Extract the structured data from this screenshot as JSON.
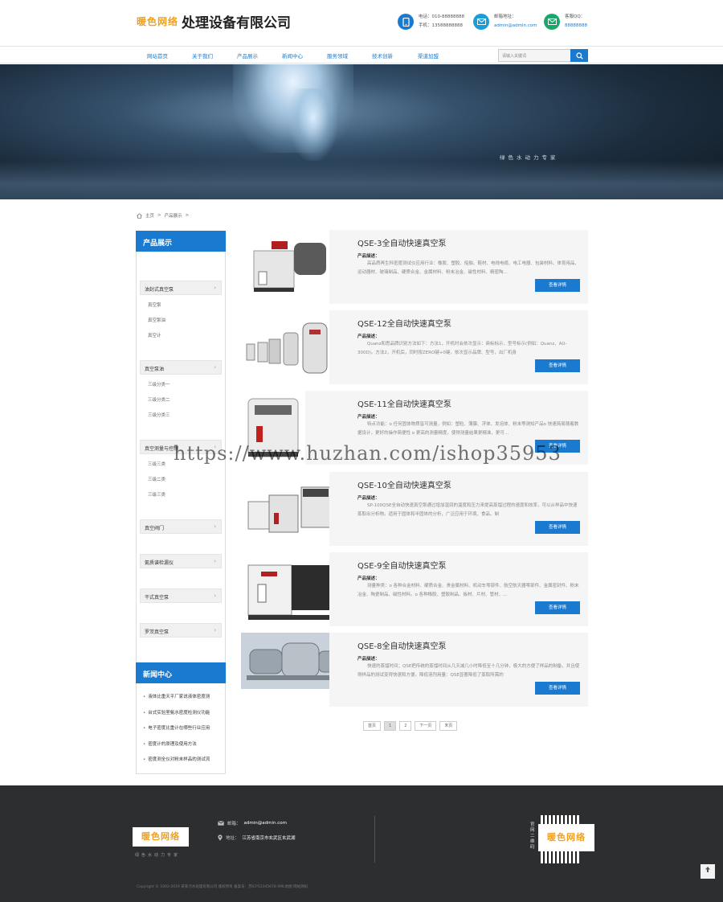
{
  "header": {
    "logo_text": "暖色网络",
    "company_name": "处理设备有限公司",
    "phone_label": "电话：010-88888888",
    "mobile_label": "手机：13588888888",
    "email_label": "邮箱地址：",
    "email_value": "admin@admin.com",
    "qq_label": "客服QQ：",
    "qq_value": "88888888"
  },
  "nav": {
    "items": [
      "网站首页",
      "关于我们",
      "产品展示",
      "新闻中心",
      "服务领域",
      "技术创新",
      "渠道加盟"
    ],
    "search_placeholder": "请输入关键词"
  },
  "banner": {
    "slogan": "绿色水动力专家"
  },
  "breadcrumb": {
    "home": "主页",
    "current": "产品展示"
  },
  "sidebar": {
    "title": "产品展示",
    "categories": [
      {
        "label": "油封式真空泵",
        "subs": [
          "真空泵",
          "真空泵油",
          "真空计"
        ]
      },
      {
        "label": "真空泵油",
        "subs": [
          "三级分类一",
          "三级分类二",
          "三级分类三"
        ]
      },
      {
        "label": "真空测量与控制",
        "subs": [
          "三级三类",
          "三级二类",
          "三级三类"
        ]
      },
      {
        "label": "真空阀门",
        "subs": []
      },
      {
        "label": "氦质谱检漏仪",
        "subs": []
      },
      {
        "label": "干式真空泵",
        "subs": []
      },
      {
        "label": "罗茨真空泵",
        "subs": []
      }
    ],
    "news_title": "新闻中心",
    "news": [
      "液体比重天平厂家说液体密度测",
      "台式实验室氨水密度检测仪功能",
      "电子密度比重计在哪些行业应用",
      "密度计的原理及使用方法",
      "密度测全仪对粉末样品的测试流"
    ]
  },
  "products": {
    "desc_label": "产品描述：",
    "button_label": "查看详情",
    "items": [
      {
        "title": "QSE-3全自动快速真空泵",
        "desc": "高品质再生科密度测试仪应用行业：橡胶、塑胶、船舶、鞋材、电线电缆、电工电器、包装材料、体育用品、运动器材、玻璃制品、硬质合金、金属材料、粉末冶金、磁性材料、精密陶..."
      },
      {
        "title": "QSE-12全自动快速真空泵",
        "desc": "Quanz和思品牌识别方法如下：方法1，开机时会依次显示：商标标示、型号标示(例如：Quanz、AU-300D)。方法2，开机后，同时按ZERO键+0键，依次显示品牌、型号，出厂机身"
      },
      {
        "title": "QSE-11全自动快速真空泵",
        "desc": "特点功能：o 任何固体物质皆可测量，例如：塑粒、薄膜、浮体、发泡体、粉末等测知产品o 快速简易随着数据设计，更好的操作简便性 o 更高的测量精度，使得测量结果更精准，更可..."
      },
      {
        "title": "QSE-10全自动快速真空泵",
        "desc": "SP-100QSE全自动快速真空泵通过增加湿润的温度和压力来提高蒸馏过程的速度和效率，可以从样品中快速蒸取出分析物。适用于固体和半固体的分析，广泛应用于环境、食品、制"
      },
      {
        "title": "QSE-9全自动快速真空泵",
        "desc": "测量种类：o 各种合金材料、硬质合金、贵金属材料、机动车零部件、航空航天器零部件、金属密封件、粉末冶金、陶瓷制品、磁性材料。o 各种橡胶、塑胶制品、板材、片材、管材、..."
      },
      {
        "title": "QSE-8全自动快速真空泵",
        "desc": "快速的蒸馏时间；QSE把传统的蒸馏时间从几天减几小时降低至十几分钟，极大的方便了样品的制备，并且使得样品的测试变得快速和方便。降低溶剂用量：QSE显著降低了蒸取所需的"
      }
    ]
  },
  "pager": {
    "items": [
      "首页",
      "1",
      "2",
      "下一页",
      "末页"
    ],
    "current": "1"
  },
  "watermark": "https://www.huzhan.com/ishop35953",
  "footer": {
    "logo_text": "暖色网络",
    "slogan": "绿色水动力专家",
    "email_label": "邮箱：",
    "email_value": "admin@admin.com",
    "address_label": "地址：",
    "address_value": "江苏省南京市玄武区玄武湖",
    "qr_label": "官网二维码",
    "qr_badge": "暖色网络",
    "copyright": "Copyright © 2002-2019 某某污水处理有限公司 版权所有 备案号：苏ICP12345678 XML地图 网站源码"
  },
  "colors": {
    "accent": "#1a7ad0",
    "footer_bg": "#2c2e30",
    "phone_icon": "#1a7ad0",
    "email_icon": "#1a9ed8",
    "qq_icon": "#1aa86a"
  }
}
